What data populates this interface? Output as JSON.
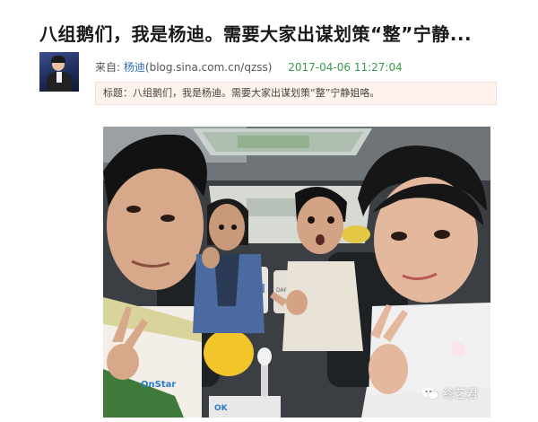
{
  "article": {
    "title": "八组鹅们，我是杨迪。需要大家出谋划策“整”宁静...",
    "source_prefix": "来自:",
    "author": "杨迪",
    "url": "(blog.sina.com.cn/qzss)",
    "timestamp": "2017-04-06 11:27:04",
    "summary": "标题：八组鹅们，我是杨迪。需要大家出谋划策“整”宁静姐咯。"
  },
  "photo": {
    "jersey_text": "OnStar",
    "bottom_logo": "OK",
    "mug_text": "DARL"
  },
  "watermark": {
    "icon": "wechat-icon",
    "text": "综艺君"
  }
}
